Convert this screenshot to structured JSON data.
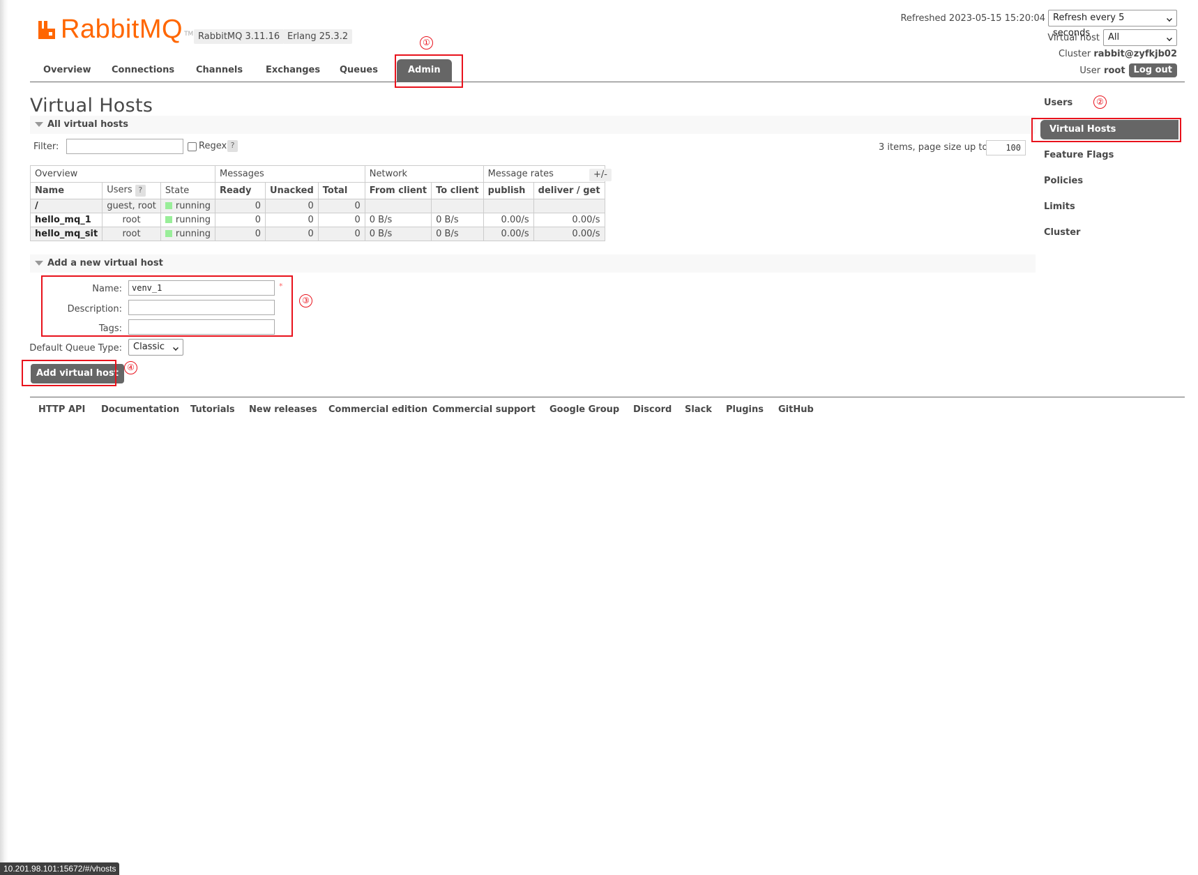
{
  "header": {
    "logo_text": "RabbitMQ",
    "logo_tm": "TM",
    "rabbitmq_version": "RabbitMQ 3.11.16",
    "erlang_version": "Erlang 25.3.2",
    "refreshed_label": "Refreshed 2023-05-15 15:20:04",
    "refresh_select": "Refresh every 5 seconds",
    "vhost_label": "Virtual host",
    "vhost_select": "All",
    "cluster_label": "Cluster",
    "cluster_name": "rabbit@zyfkjb02",
    "user_label": "User",
    "user_name": "root",
    "logout_label": "Log out"
  },
  "tabs": [
    {
      "label": "Overview"
    },
    {
      "label": "Connections"
    },
    {
      "label": "Channels"
    },
    {
      "label": "Exchanges"
    },
    {
      "label": "Queues"
    },
    {
      "label": "Admin",
      "active": true
    }
  ],
  "page": {
    "title": "Virtual Hosts",
    "all_section": "All virtual hosts",
    "filter_label": "Filter:",
    "filter_value": "",
    "regex_label": "Regex",
    "help_glyph": "?",
    "items_label": "3 items, page size up to",
    "page_size": "100",
    "plus_minus": "+/-"
  },
  "table": {
    "groups": [
      "Overview",
      "Messages",
      "Network",
      "Message rates"
    ],
    "columns": [
      "Name",
      "Users",
      "State",
      "Ready",
      "Unacked",
      "Total",
      "From client",
      "To client",
      "publish",
      "deliver / get"
    ],
    "rows": [
      {
        "name": "/",
        "users": "guest, root",
        "state": "running",
        "ready": "0",
        "unacked": "0",
        "total": "0",
        "from_client": "",
        "to_client": "",
        "publish": "",
        "deliver_get": ""
      },
      {
        "name": "hello_mq_1",
        "users": "root",
        "state": "running",
        "ready": "0",
        "unacked": "0",
        "total": "0",
        "from_client": "0 B/s",
        "to_client": "0 B/s",
        "publish": "0.00/s",
        "deliver_get": "0.00/s"
      },
      {
        "name": "hello_mq_sit",
        "users": "root",
        "state": "running",
        "ready": "0",
        "unacked": "0",
        "total": "0",
        "from_client": "0 B/s",
        "to_client": "0 B/s",
        "publish": "0.00/s",
        "deliver_get": "0.00/s"
      }
    ]
  },
  "add_form": {
    "section": "Add a new virtual host",
    "name_label": "Name:",
    "name_value": "venv_1",
    "required_mark": "*",
    "description_label": "Description:",
    "description_value": "",
    "tags_label": "Tags:",
    "tags_value": "",
    "queue_type_label": "Default Queue Type:",
    "queue_type_value": "Classic",
    "submit_label": "Add virtual host"
  },
  "sidebar": [
    {
      "label": "Users"
    },
    {
      "label": "Virtual Hosts",
      "active": true
    },
    {
      "label": "Feature Flags"
    },
    {
      "label": "Policies"
    },
    {
      "label": "Limits"
    },
    {
      "label": "Cluster"
    }
  ],
  "footer": [
    {
      "label": "HTTP API"
    },
    {
      "label": "Documentation"
    },
    {
      "label": "Tutorials"
    },
    {
      "label": "New releases"
    },
    {
      "label": "Commercial edition"
    },
    {
      "label": "Commercial support"
    },
    {
      "label": "Google Group"
    },
    {
      "label": "Discord"
    },
    {
      "label": "Slack"
    },
    {
      "label": "Plugins"
    },
    {
      "label": "GitHub"
    }
  ],
  "annotations": [
    "①",
    "②",
    "③",
    "④"
  ],
  "status_url": "10.201.98.101:15672/#/vhosts",
  "colors": {
    "brand_orange": "#ff6600",
    "nav_active": "#666666",
    "annotation_red": "#e8121c",
    "state_running": "#99ee99"
  }
}
